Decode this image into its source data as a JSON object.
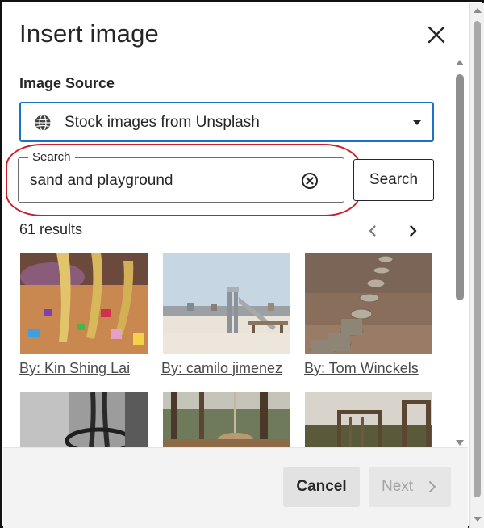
{
  "dialog": {
    "title": "Insert image",
    "close_icon": "close-icon"
  },
  "source": {
    "label": "Image Source",
    "selected": "Stock images from Unsplash",
    "icon": "globe-icon"
  },
  "search": {
    "legend": "Search",
    "value": "sand and playground",
    "button_label": "Search",
    "clear_icon": "clear-circle-icon",
    "highlight_color": "#c8202e"
  },
  "results": {
    "count_text": "61 results",
    "prev_icon": "chevron-left-icon",
    "next_icon": "chevron-right-icon",
    "items": [
      {
        "credit": "By: Kin Shing Lai"
      },
      {
        "credit": "By: camilo jimenez"
      },
      {
        "credit": "By: Tom Winckels"
      },
      {
        "credit": ""
      },
      {
        "credit": ""
      },
      {
        "credit": ""
      }
    ]
  },
  "footer": {
    "cancel_label": "Cancel",
    "next_label": "Next"
  },
  "colors": {
    "accent": "#1a73c8",
    "text": "#262626",
    "disabled_text": "#a3a3a3",
    "footer_bg": "#f3f3f3"
  }
}
